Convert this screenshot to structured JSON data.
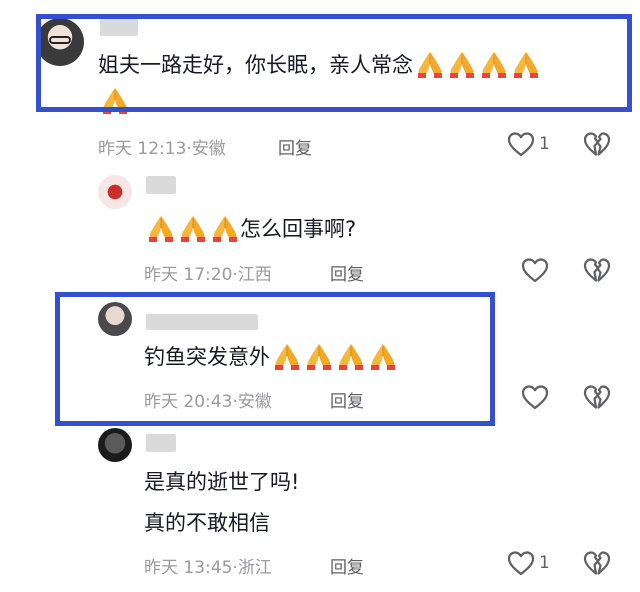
{
  "comments": [
    {
      "text": "姐夫一路走好，你长眠，亲人常念",
      "emoji_count_line1": 4,
      "emoji_count_line2": 1,
      "time": "昨天 12:13",
      "location": "安徽",
      "reply_label": "回复",
      "like_count": "1"
    },
    {
      "text": "怎么回事啊?",
      "emoji_prefix_count": 3,
      "time": "昨天 17:20",
      "location": "江西",
      "reply_label": "回复"
    },
    {
      "text": "钓鱼突发意外",
      "emoji_count": 4,
      "time": "昨天 20:43",
      "location": "安徽",
      "reply_label": "回复"
    },
    {
      "text_line1": "是真的逝世了吗!",
      "text_line2": "真的不敢相信",
      "time": "昨天 13:45",
      "location": "浙江",
      "reply_label": "回复",
      "like_count": "1"
    }
  ],
  "colors": {
    "highlight_border": "#3450d0",
    "meta_text": "#9a9aa0",
    "body_text": "#161823"
  },
  "icons": {
    "like": "heart-outline-icon",
    "dislike": "broken-heart-icon",
    "emoji": "folded-hands-emoji"
  }
}
